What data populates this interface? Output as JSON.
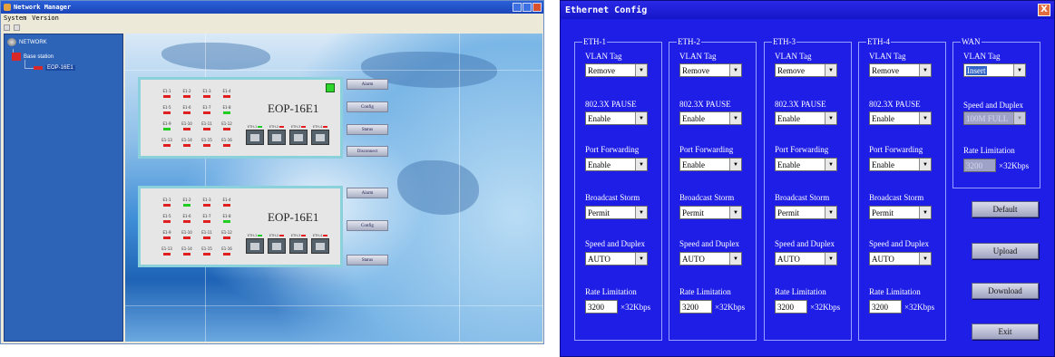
{
  "network_manager": {
    "title": "Network Manager",
    "menu": [
      "System",
      "Version"
    ],
    "tree": {
      "root": "NETWORK",
      "station": "Base station",
      "device": "EOP-16E1"
    },
    "devices": [
      {
        "name": "EOP-16E1",
        "e1_ports": [
          {
            "label": "E1-1",
            "color": "#e02020"
          },
          {
            "label": "E1-2",
            "color": "#e02020"
          },
          {
            "label": "E1-3",
            "color": "#e02020"
          },
          {
            "label": "E1-4",
            "color": "#e02020"
          },
          {
            "label": "E1-5",
            "color": "#e02020"
          },
          {
            "label": "E1-6",
            "color": "#e02020"
          },
          {
            "label": "E1-7",
            "color": "#e02020"
          },
          {
            "label": "E1-8",
            "color": "#22cc22"
          },
          {
            "label": "E1-9",
            "color": "#22cc22"
          },
          {
            "label": "E1-10",
            "color": "#e02020"
          },
          {
            "label": "E1-11",
            "color": "#e02020"
          },
          {
            "label": "E1-12",
            "color": "#e02020"
          },
          {
            "label": "E1-13",
            "color": "#e02020"
          },
          {
            "label": "E1-14",
            "color": "#e02020"
          },
          {
            "label": "E1-15",
            "color": "#e02020"
          },
          {
            "label": "E1-16",
            "color": "#e02020"
          }
        ],
        "eth_ports": [
          {
            "label": "ETH-1",
            "color": "#22cc22"
          },
          {
            "label": "ETH-2",
            "color": "#e02020"
          },
          {
            "label": "ETH-3",
            "color": "#e02020"
          },
          {
            "label": "ETH-4",
            "color": "#e02020"
          }
        ],
        "buttons": [
          "Alarm",
          "Config",
          "Status",
          "Disconnect"
        ],
        "status_light": "#2dd52d"
      },
      {
        "name": "EOP-16E1",
        "e1_ports": [
          {
            "label": "E1-1",
            "color": "#e02020"
          },
          {
            "label": "E1-2",
            "color": "#22cc22"
          },
          {
            "label": "E1-3",
            "color": "#e02020"
          },
          {
            "label": "E1-4",
            "color": "#e02020"
          },
          {
            "label": "E1-5",
            "color": "#e02020"
          },
          {
            "label": "E1-6",
            "color": "#e02020"
          },
          {
            "label": "E1-7",
            "color": "#e02020"
          },
          {
            "label": "E1-8",
            "color": "#22cc22"
          },
          {
            "label": "E1-9",
            "color": "#e02020"
          },
          {
            "label": "E1-10",
            "color": "#e02020"
          },
          {
            "label": "E1-11",
            "color": "#e02020"
          },
          {
            "label": "E1-12",
            "color": "#e02020"
          },
          {
            "label": "E1-13",
            "color": "#e02020"
          },
          {
            "label": "E1-14",
            "color": "#e02020"
          },
          {
            "label": "E1-15",
            "color": "#e02020"
          },
          {
            "label": "E1-16",
            "color": "#e02020"
          }
        ],
        "eth_ports": [
          {
            "label": "ETH-1",
            "color": "#22cc22"
          },
          {
            "label": "ETH-2",
            "color": "#e02020"
          },
          {
            "label": "ETH-3",
            "color": "#e02020"
          },
          {
            "label": "ETH-4",
            "color": "#e02020"
          }
        ],
        "buttons": [
          "Alarm",
          "Config",
          "Status"
        ]
      }
    ]
  },
  "ethernet_config": {
    "title": "Ethernet Config",
    "close_label": "X",
    "groups": [
      {
        "name": "ETH-1",
        "vlan_tag_label": "VLAN Tag",
        "vlan_tag_value": "Remove",
        "pause_label": "802.3X PAUSE",
        "pause_value": "Enable",
        "forwarding_label": "Port Forwarding",
        "forwarding_value": "Enable",
        "storm_label": "Broadcast Storm",
        "storm_value": "Permit",
        "duplex_label": "Speed and Duplex",
        "duplex_value": "AUTO",
        "rate_label": "Rate Limitation",
        "rate_value": "3200",
        "rate_unit": "×32Kbps"
      },
      {
        "name": "ETH-2",
        "vlan_tag_label": "VLAN Tag",
        "vlan_tag_value": "Remove",
        "pause_label": "802.3X PAUSE",
        "pause_value": "Enable",
        "forwarding_label": "Port Forwarding",
        "forwarding_value": "Enable",
        "storm_label": "Broadcast Storm",
        "storm_value": "Permit",
        "duplex_label": "Speed and Duplex",
        "duplex_value": "AUTO",
        "rate_label": "Rate Limitation",
        "rate_value": "3200",
        "rate_unit": "×32Kbps"
      },
      {
        "name": "ETH-3",
        "vlan_tag_label": "VLAN Tag",
        "vlan_tag_value": "Remove",
        "pause_label": "802.3X PAUSE",
        "pause_value": "Enable",
        "forwarding_label": "Port Forwarding",
        "forwarding_value": "Enable",
        "storm_label": "Broadcast Storm",
        "storm_value": "Permit",
        "duplex_label": "Speed and Duplex",
        "duplex_value": "AUTO",
        "rate_label": "Rate Limitation",
        "rate_value": "3200",
        "rate_unit": "×32Kbps"
      },
      {
        "name": "ETH-4",
        "vlan_tag_label": "VLAN Tag",
        "vlan_tag_value": "Remove",
        "pause_label": "802.3X PAUSE",
        "pause_value": "Enable",
        "forwarding_label": "Port Forwarding",
        "forwarding_value": "Enable",
        "storm_label": "Broadcast Storm",
        "storm_value": "Permit",
        "duplex_label": "Speed and Duplex",
        "duplex_value": "AUTO",
        "rate_label": "Rate Limitation",
        "rate_value": "3200",
        "rate_unit": "×32Kbps"
      }
    ],
    "wan": {
      "name": "WAN",
      "vlan_tag_label": "VLAN Tag",
      "vlan_tag_value": "Insert",
      "duplex_label": "Speed and Duplex",
      "duplex_value": "100M FULL",
      "rate_label": "Rate Limitation",
      "rate_value": "3200",
      "rate_unit": "×32Kbps"
    },
    "buttons": {
      "default": "Default",
      "upload": "Upload",
      "download": "Download",
      "exit": "Exit"
    }
  }
}
